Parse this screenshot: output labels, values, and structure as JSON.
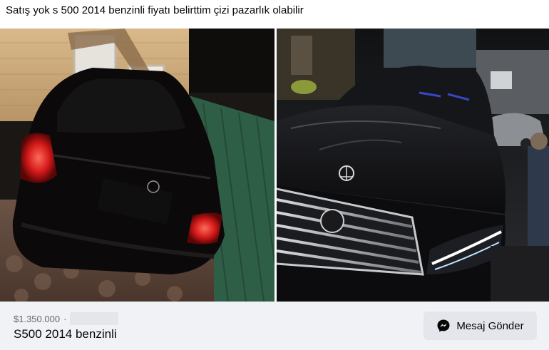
{
  "post": {
    "caption": "Satış yok s 500 2014 benzinli fiyatı belirttim çizi pazarlık olabilir"
  },
  "photos": [
    {
      "icon": "car-rear-photo"
    },
    {
      "icon": "car-front-photo"
    }
  ],
  "listing": {
    "price": "$1.350.000",
    "separator": "·",
    "title": "S500 2014 benzinli"
  },
  "actions": {
    "message_label": "Mesaj Gönder",
    "message_icon": "messenger-icon"
  },
  "colors": {
    "bar_background": "#f0f2f5",
    "button_background": "#e4e6eb",
    "text_primary": "#050505",
    "text_secondary": "#65676b"
  }
}
